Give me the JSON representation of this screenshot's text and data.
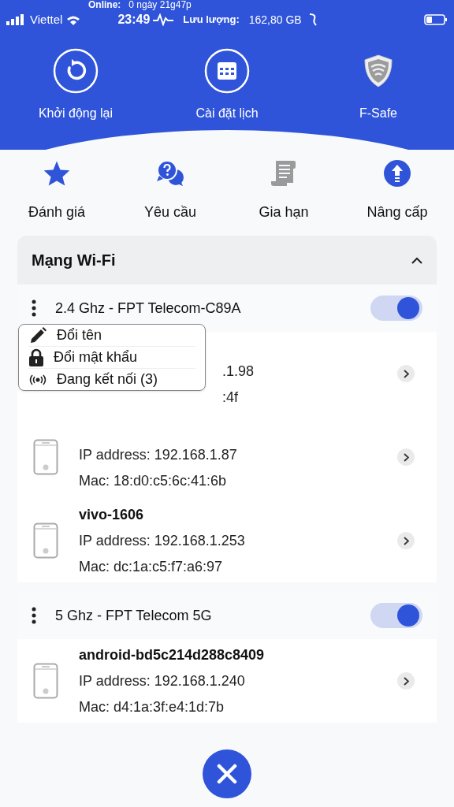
{
  "status_bar": {
    "carrier": "Viettel",
    "time": "23:49",
    "online_label": "Online:",
    "online_value": "0 ngày 21g47p",
    "traffic_label": "Lưu lượng:",
    "traffic_value": "162,80 GB"
  },
  "top_actions": [
    {
      "label": "Khởi động lại",
      "kind": "restart"
    },
    {
      "label": "Cài đặt lịch",
      "kind": "calendar"
    },
    {
      "label": "F-Safe",
      "kind": "shield"
    }
  ],
  "quick_actions": [
    {
      "label": "Đánh giá",
      "kind": "star"
    },
    {
      "label": "Yêu cầu",
      "kind": "chat"
    },
    {
      "label": "Gia hạn",
      "kind": "scroll"
    },
    {
      "label": "Nâng cấp",
      "kind": "upgrade"
    }
  ],
  "wifi": {
    "title": "Mạng Wi-Fi",
    "expanded": true,
    "bands": [
      {
        "name": "2.4 Ghz - FPT Telecom-C89A",
        "on": true,
        "devices": [
          {
            "kind": "covered",
            "ip": ".1.98",
            "mac": ":4f"
          },
          {
            "kind": "icon_only",
            "ip": "IP address: 192.168.1.87",
            "mac": "Mac: 18:d0:c5:6c:41:6b"
          },
          {
            "kind": "full",
            "name": "vivo-1606",
            "ip": "IP address: 192.168.1.253",
            "mac": "Mac: dc:1a:c5:f7:a6:97"
          }
        ]
      },
      {
        "name": "5 Ghz - FPT Telecom 5G",
        "on": true,
        "devices": [
          {
            "kind": "full",
            "name": "android-bd5c214d288c8409",
            "ip": "IP address: 192.168.1.240",
            "mac": "Mac: d4:1a:3f:e4:1d:7b"
          }
        ]
      }
    ]
  },
  "menu": [
    {
      "label": "Đổi tên",
      "kind": "pencil"
    },
    {
      "label": "Đổi mật khẩu",
      "kind": "lock"
    },
    {
      "label": "Đang kết nối (3)",
      "kind": "broadcast"
    }
  ]
}
